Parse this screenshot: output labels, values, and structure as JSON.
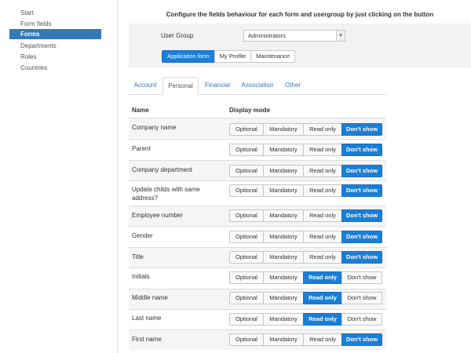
{
  "sidebar": {
    "items": [
      {
        "label": "Start",
        "active": false
      },
      {
        "label": "Form fields",
        "active": false
      },
      {
        "label": "Forms",
        "active": true
      },
      {
        "label": "Departments",
        "active": false
      },
      {
        "label": "Roles",
        "active": false
      },
      {
        "label": "Countries",
        "active": false
      }
    ]
  },
  "header": {
    "title": "Configure the fields behaviour for each form and usergroup by just clicking on the button"
  },
  "filter": {
    "user_group_label": "User Group",
    "user_group_value": "Administrators",
    "form_tabs": [
      {
        "label": "Application form",
        "active": true
      },
      {
        "label": "My Profile",
        "active": false
      },
      {
        "label": "Maintenance",
        "active": false
      }
    ]
  },
  "category_tabs": [
    {
      "label": "Account",
      "active": false
    },
    {
      "label": "Personal",
      "active": true
    },
    {
      "label": "Financial",
      "active": false
    },
    {
      "label": "Association",
      "active": false
    },
    {
      "label": "Other",
      "active": false
    }
  ],
  "table": {
    "columns": [
      "Name",
      "Display mode"
    ],
    "mode_options": [
      "Optional",
      "Mandatory",
      "Read only",
      "Don't show"
    ],
    "rows": [
      {
        "name": "Company name",
        "selected": "Don't show"
      },
      {
        "name": "Parent",
        "selected": "Don't show"
      },
      {
        "name": "Company department",
        "selected": "Don't show"
      },
      {
        "name": "Update childs with same address?",
        "selected": "Don't show"
      },
      {
        "name": "Employee number",
        "selected": "Don't show"
      },
      {
        "name": "Gender",
        "selected": "Don't show"
      },
      {
        "name": "Title",
        "selected": "Don't show"
      },
      {
        "name": "Initials",
        "selected": "Read only"
      },
      {
        "name": "Middle name",
        "selected": "Read only"
      },
      {
        "name": "Last name",
        "selected": "Read only"
      },
      {
        "name": "First name",
        "selected": "Don't show"
      }
    ]
  },
  "colors": {
    "accent": "#1a7fd6",
    "sidebar_active": "#337ab7",
    "link": "#337ab7"
  }
}
